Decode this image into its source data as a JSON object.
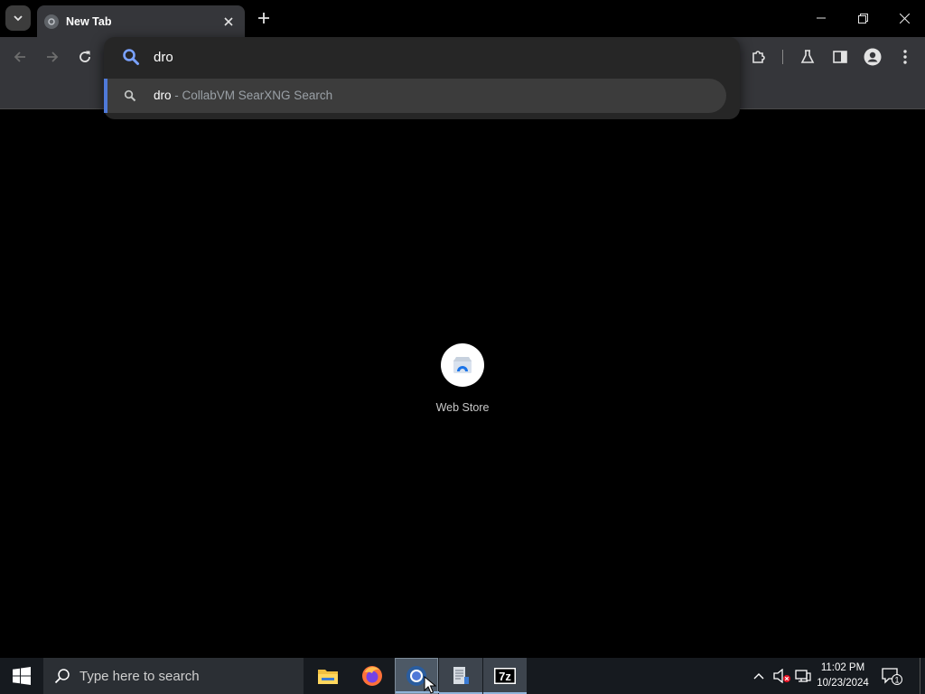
{
  "browser": {
    "tab": {
      "title": "New Tab"
    },
    "omnibox": {
      "value": "dro",
      "suggestion": {
        "query": "dro",
        "separator": " - ",
        "engine": "CollabVM SearXNG Search"
      }
    },
    "accent_color": "#4f79d8"
  },
  "ntp": {
    "shortcuts": [
      {
        "label": "Web Store"
      }
    ]
  },
  "taskbar": {
    "search_placeholder": "Type here to search",
    "time": "11:02 PM",
    "date": "10/23/2024",
    "notification_count": "1",
    "apps": [
      {
        "name": "file-explorer-icon"
      },
      {
        "name": "firefox-icon"
      },
      {
        "name": "chrome-icon"
      },
      {
        "name": "notepad-icon"
      },
      {
        "name": "7zip-icon",
        "text": "7z"
      }
    ]
  }
}
